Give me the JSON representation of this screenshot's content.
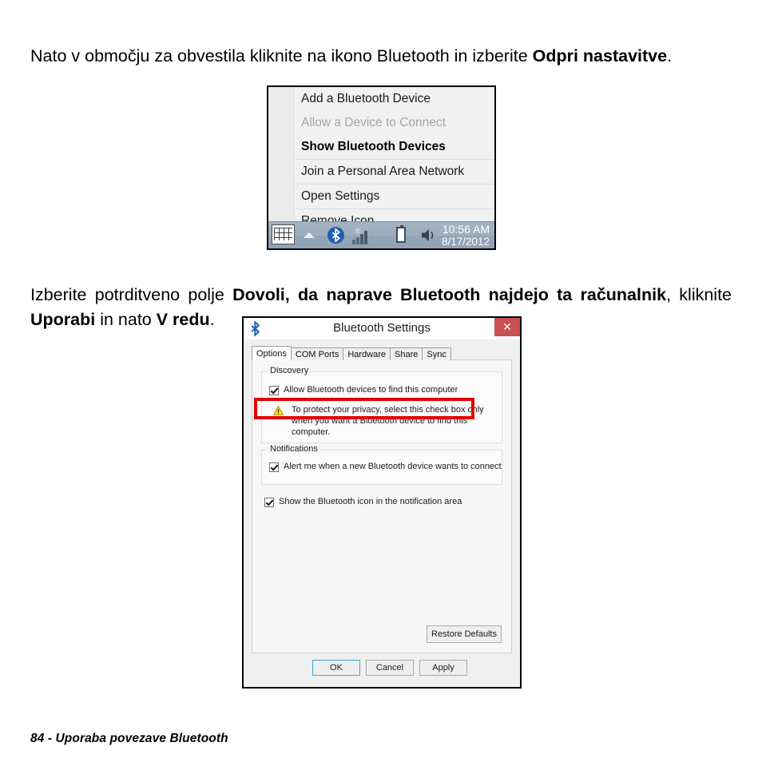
{
  "document": {
    "paragraph_1": {
      "parts": [
        {
          "text": "Nato v območju za obvestila kliknite na ikono Bluetooth in izberite ",
          "bold": false
        },
        {
          "text": "Odpri nastavitve",
          "bold": true
        },
        {
          "text": ".",
          "bold": false
        }
      ]
    },
    "paragraph_2": {
      "parts": [
        {
          "text": "Izberite potrditveno polje ",
          "bold": false
        },
        {
          "text": "Dovoli, da naprave Bluetooth najdejo ta računalnik",
          "bold": true
        },
        {
          "text": ", kliknite ",
          "bold": false
        },
        {
          "text": "Uporabi",
          "bold": true
        },
        {
          "text": " in nato ",
          "bold": false
        },
        {
          "text": "V redu",
          "bold": true
        },
        {
          "text": ".",
          "bold": false
        }
      ]
    },
    "footer": "84 - Uporaba povezave Bluetooth"
  },
  "tray_menu": {
    "groups": [
      {
        "items": [
          {
            "label": "Add a Bluetooth Device",
            "state": "normal"
          },
          {
            "label": "Allow a Device to Connect",
            "state": "disabled"
          },
          {
            "label": "Show Bluetooth Devices",
            "state": "default"
          }
        ]
      },
      {
        "items": [
          {
            "label": "Join a Personal Area Network",
            "state": "normal"
          }
        ]
      },
      {
        "items": [
          {
            "label": "Open Settings",
            "state": "normal"
          }
        ]
      },
      {
        "items": [
          {
            "label": "Remove Icon",
            "state": "normal"
          }
        ]
      }
    ]
  },
  "taskbar": {
    "icons": [
      {
        "name": "keyboard-icon"
      },
      {
        "name": "chevron-up-icon"
      },
      {
        "name": "bluetooth-icon"
      },
      {
        "name": "network-signal-icon"
      },
      {
        "name": "battery-icon"
      },
      {
        "name": "volume-icon"
      }
    ],
    "clock": {
      "time": "10:56 AM",
      "date": "8/17/2012"
    },
    "colors": {
      "background": "#9eadbc",
      "text": "#ffffff",
      "bluetooth_blue": "#1f5fb0"
    }
  },
  "dialog": {
    "title": "Bluetooth Settings",
    "close_label": "✕",
    "titlebar_icon": "bluetooth-icon",
    "close_color": "#c75050",
    "tabs": [
      {
        "label": "Options",
        "active": true
      },
      {
        "label": "COM Ports",
        "active": false
      },
      {
        "label": "Hardware",
        "active": false
      },
      {
        "label": "Share",
        "active": false
      },
      {
        "label": "Sync",
        "active": false
      }
    ],
    "discovery": {
      "group_label": "Discovery",
      "checkbox": {
        "label": "Allow Bluetooth devices to find this computer",
        "checked": true,
        "highlighted": true,
        "highlight_color": "#e00000"
      },
      "warning": {
        "icon": "warning-triangle-icon",
        "text": "To protect your privacy, select this check box only when you want a Bluetooth device to find this computer."
      }
    },
    "notifications": {
      "group_label": "Notifications",
      "checkbox": {
        "label": "Alert me when a new Bluetooth device wants to connect",
        "checked": true
      }
    },
    "show_icon_checkbox": {
      "label": "Show the Bluetooth icon in the notification area",
      "checked": true
    },
    "buttons": {
      "restore_defaults": "Restore Defaults",
      "ok": "OK",
      "cancel": "Cancel",
      "apply": "Apply"
    }
  }
}
